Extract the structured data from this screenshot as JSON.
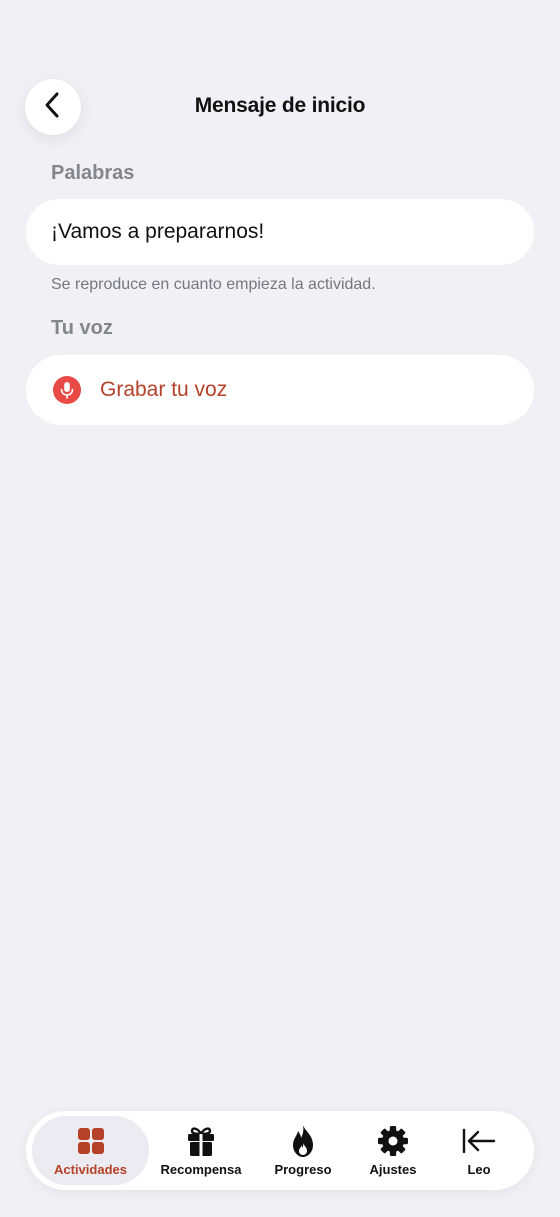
{
  "header": {
    "title": "Mensaje de inicio"
  },
  "words_section": {
    "label": "Palabras",
    "value": "¡Vamos a prepararnos!",
    "helper": "Se reproduce en cuanto empieza la actividad."
  },
  "voice_section": {
    "label": "Tu voz",
    "record_label": "Grabar tu voz"
  },
  "tab_bar": {
    "tabs": [
      {
        "label": "Actividades",
        "icon": "grid-icon",
        "active": true
      },
      {
        "label": "Recompensa",
        "icon": "gift-icon",
        "active": false
      },
      {
        "label": "Progreso",
        "icon": "flame-icon",
        "active": false
      },
      {
        "label": "Ajustes",
        "icon": "gear-icon",
        "active": false
      },
      {
        "label": "Leo",
        "icon": "arrow-left-bar-icon",
        "active": false
      }
    ]
  },
  "colors": {
    "background": "#f1f0f5",
    "accent": "#b54129",
    "mic": "#e84a45",
    "secondary_text": "#85858c"
  }
}
